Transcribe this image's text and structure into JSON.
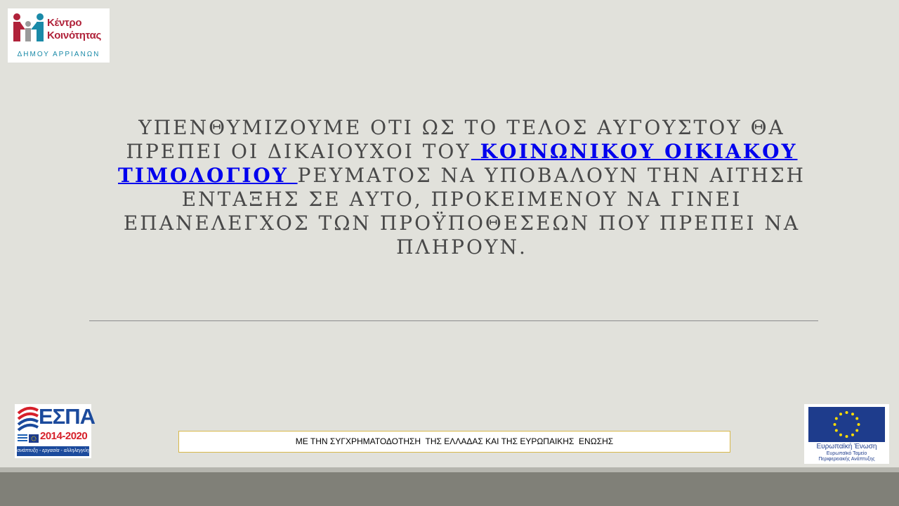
{
  "logo_top": {
    "line1": "Κέντρο",
    "line2": "Κοινότητας",
    "line3": "ΔΗΜΟΥ ΑΡΡΙΑΝΩΝ"
  },
  "message": {
    "part1": "ΥΠΕΝΘΥΜΙΖΟΥΜΕ ΟΤΙ ΩΣ ΤΟ ΤΕΛΟΣ ΑΥΓΟΥΣΤΟΥ ΘΑ ΠΡΕΠΕΙ ΟΙ ΔΙΚΑΙΟΥΧΟΙ ΤΟΥ",
    "link": " ΚΟΙΝΩΝΙΚΟΥ ΟΙΚΙΑΚΟΥ ΤΙΜΟΛΟΓΙΟΥ ",
    "part2": "ΡΕΥΜΑΤΟΣ ΝΑ ΥΠΟΒΑΛΟΥΝ ΤΗΝ ΑΙΤΗΣΗ ΕΝΤΑΞΗΣ ΣΕ ΑΥΤΟ, ΠΡΟΚΕΙΜΕΝΟΥ ΝΑ ΓΙΝΕΙ ΕΠΑΝΕΛΕΓΧΟΣ ΤΩΝ ΠΡΟΫΠΟΘΕΣΕΩΝ ΠΟΥ ΠΡΕΠΕΙ ΝΑ ΠΛΗΡΟΥΝ."
  },
  "espa": {
    "title": "ΕΣΠΑ",
    "years": "2014-2020",
    "tagline": "ανάπτυξη - εργασία - αλληλεγγύη"
  },
  "banner": {
    "text": "ΜΕ ΤΗΝ ΣΥΓΧΡΗΜΑΤΟΔΟΤΗΣΗ  ΤΗΣ ΕΛΛΑΔΑΣ ΚΑΙ ΤΗΣ ΕΥΡΩΠΑΙΚΗΣ  ΕΝΩΣΗΣ"
  },
  "eu": {
    "line1": "Ευρωπαϊκή Ένωση",
    "line2": "Ευρωπαϊκό Ταμείο",
    "line3": "Περιφερειακής Ανάπτυξης"
  },
  "colors": {
    "background": "#e1e1db",
    "text": "#484848",
    "link": "#0000ee",
    "footer": "#808078",
    "banner_border": "#d8b84a",
    "eu_blue": "#1e3c8c",
    "eu_star": "#ffdd00"
  }
}
